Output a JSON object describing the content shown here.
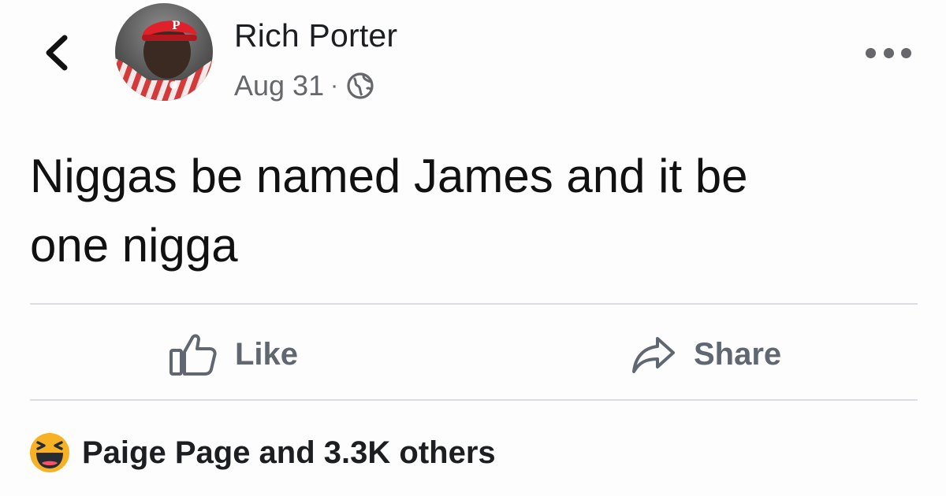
{
  "post": {
    "author": "Rich Porter",
    "date": "Aug 31",
    "separator": "·",
    "text_line1": "Niggas be named James and it be",
    "text_line2": "one nigga"
  },
  "icons": {
    "back": "chevron-left-icon",
    "privacy": "globe-icon",
    "more": "more-horizontal-icon",
    "like": "thumbs-up-icon",
    "share": "share-arrow-icon",
    "reaction": "haha-emoji-icon"
  },
  "actions": {
    "like_label": "Like",
    "share_label": "Share"
  },
  "reactions": {
    "summary": "Paige Page and 3.3K others"
  },
  "colors": {
    "text": "#1c1e21",
    "secondary": "#65676b",
    "divider": "#dadde1",
    "haha_yellow": "#f7b125"
  }
}
